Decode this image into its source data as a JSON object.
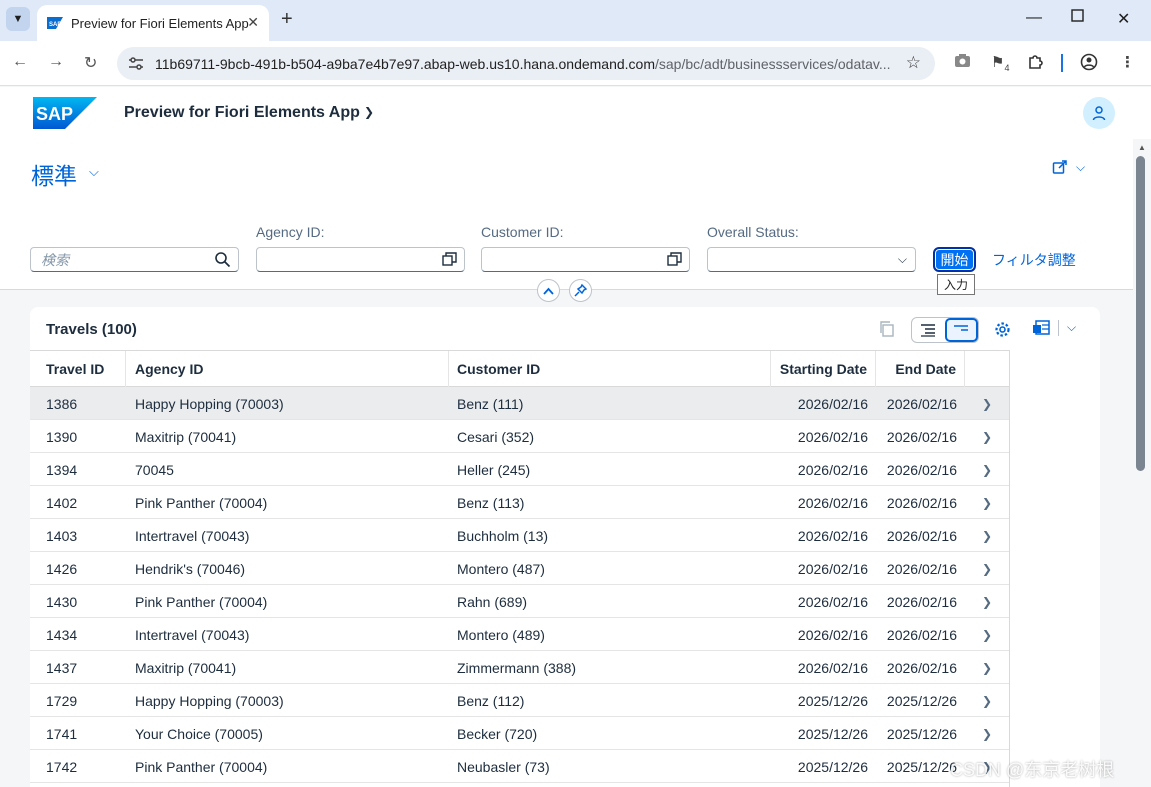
{
  "browser": {
    "tab_title": "Preview for Fiori Elements App",
    "url_host": "11b69711-9bcb-491b-b504-a9ba7e4b7e97.abap-web.us10.hana.ondemand.com",
    "url_path": "/sap/bc/adt/businessservices/odatav...",
    "extension_badge": "4"
  },
  "shell": {
    "logo_text": "SAP",
    "app_title": "Preview for Fiori Elements App"
  },
  "header": {
    "variant": "標準"
  },
  "filters": {
    "search_placeholder": "検索",
    "agency_label": "Agency ID:",
    "agency_value": "",
    "customer_label": "Customer ID:",
    "customer_value": "",
    "status_label": "Overall Status:",
    "status_value": "",
    "go_label": "開始",
    "go_tooltip": "入力",
    "adapt_label": "フィルタ調整"
  },
  "table": {
    "title": "Travels (100)",
    "columns": [
      "Travel ID",
      "Agency ID",
      "Customer ID",
      "Starting Date",
      "End Date"
    ],
    "rows": [
      [
        "1386",
        "Happy Hopping (70003)",
        "Benz (111)",
        "2026/02/16",
        "2026/02/16"
      ],
      [
        "1390",
        "Maxitrip (70041)",
        "Cesari (352)",
        "2026/02/16",
        "2026/02/16"
      ],
      [
        "1394",
        "70045",
        "Heller (245)",
        "2026/02/16",
        "2026/02/16"
      ],
      [
        "1402",
        "Pink Panther (70004)",
        "Benz (113)",
        "2026/02/16",
        "2026/02/16"
      ],
      [
        "1403",
        "Intertravel (70043)",
        "Buchholm (13)",
        "2026/02/16",
        "2026/02/16"
      ],
      [
        "1426",
        "Hendrik's (70046)",
        "Montero (487)",
        "2026/02/16",
        "2026/02/16"
      ],
      [
        "1430",
        "Pink Panther (70004)",
        "Rahn (689)",
        "2026/02/16",
        "2026/02/16"
      ],
      [
        "1434",
        "Intertravel (70043)",
        "Montero (489)",
        "2026/02/16",
        "2026/02/16"
      ],
      [
        "1437",
        "Maxitrip (70041)",
        "Zimmermann (388)",
        "2026/02/16",
        "2026/02/16"
      ],
      [
        "1729",
        "Happy Hopping (70003)",
        "Benz (112)",
        "2025/12/26",
        "2025/12/26"
      ],
      [
        "1741",
        "Your Choice (70005)",
        "Becker (720)",
        "2025/12/26",
        "2025/12/26"
      ],
      [
        "1742",
        "Pink Panther (70004)",
        "Neubasler (73)",
        "2025/12/26",
        "2025/12/26"
      ]
    ]
  },
  "watermark": "CSDN @东京老树根",
  "colors": {
    "accent": "#0064d9",
    "button": "#0070f2",
    "shell_bg": "#ffffff",
    "page_bg": "#f5f6f7"
  }
}
